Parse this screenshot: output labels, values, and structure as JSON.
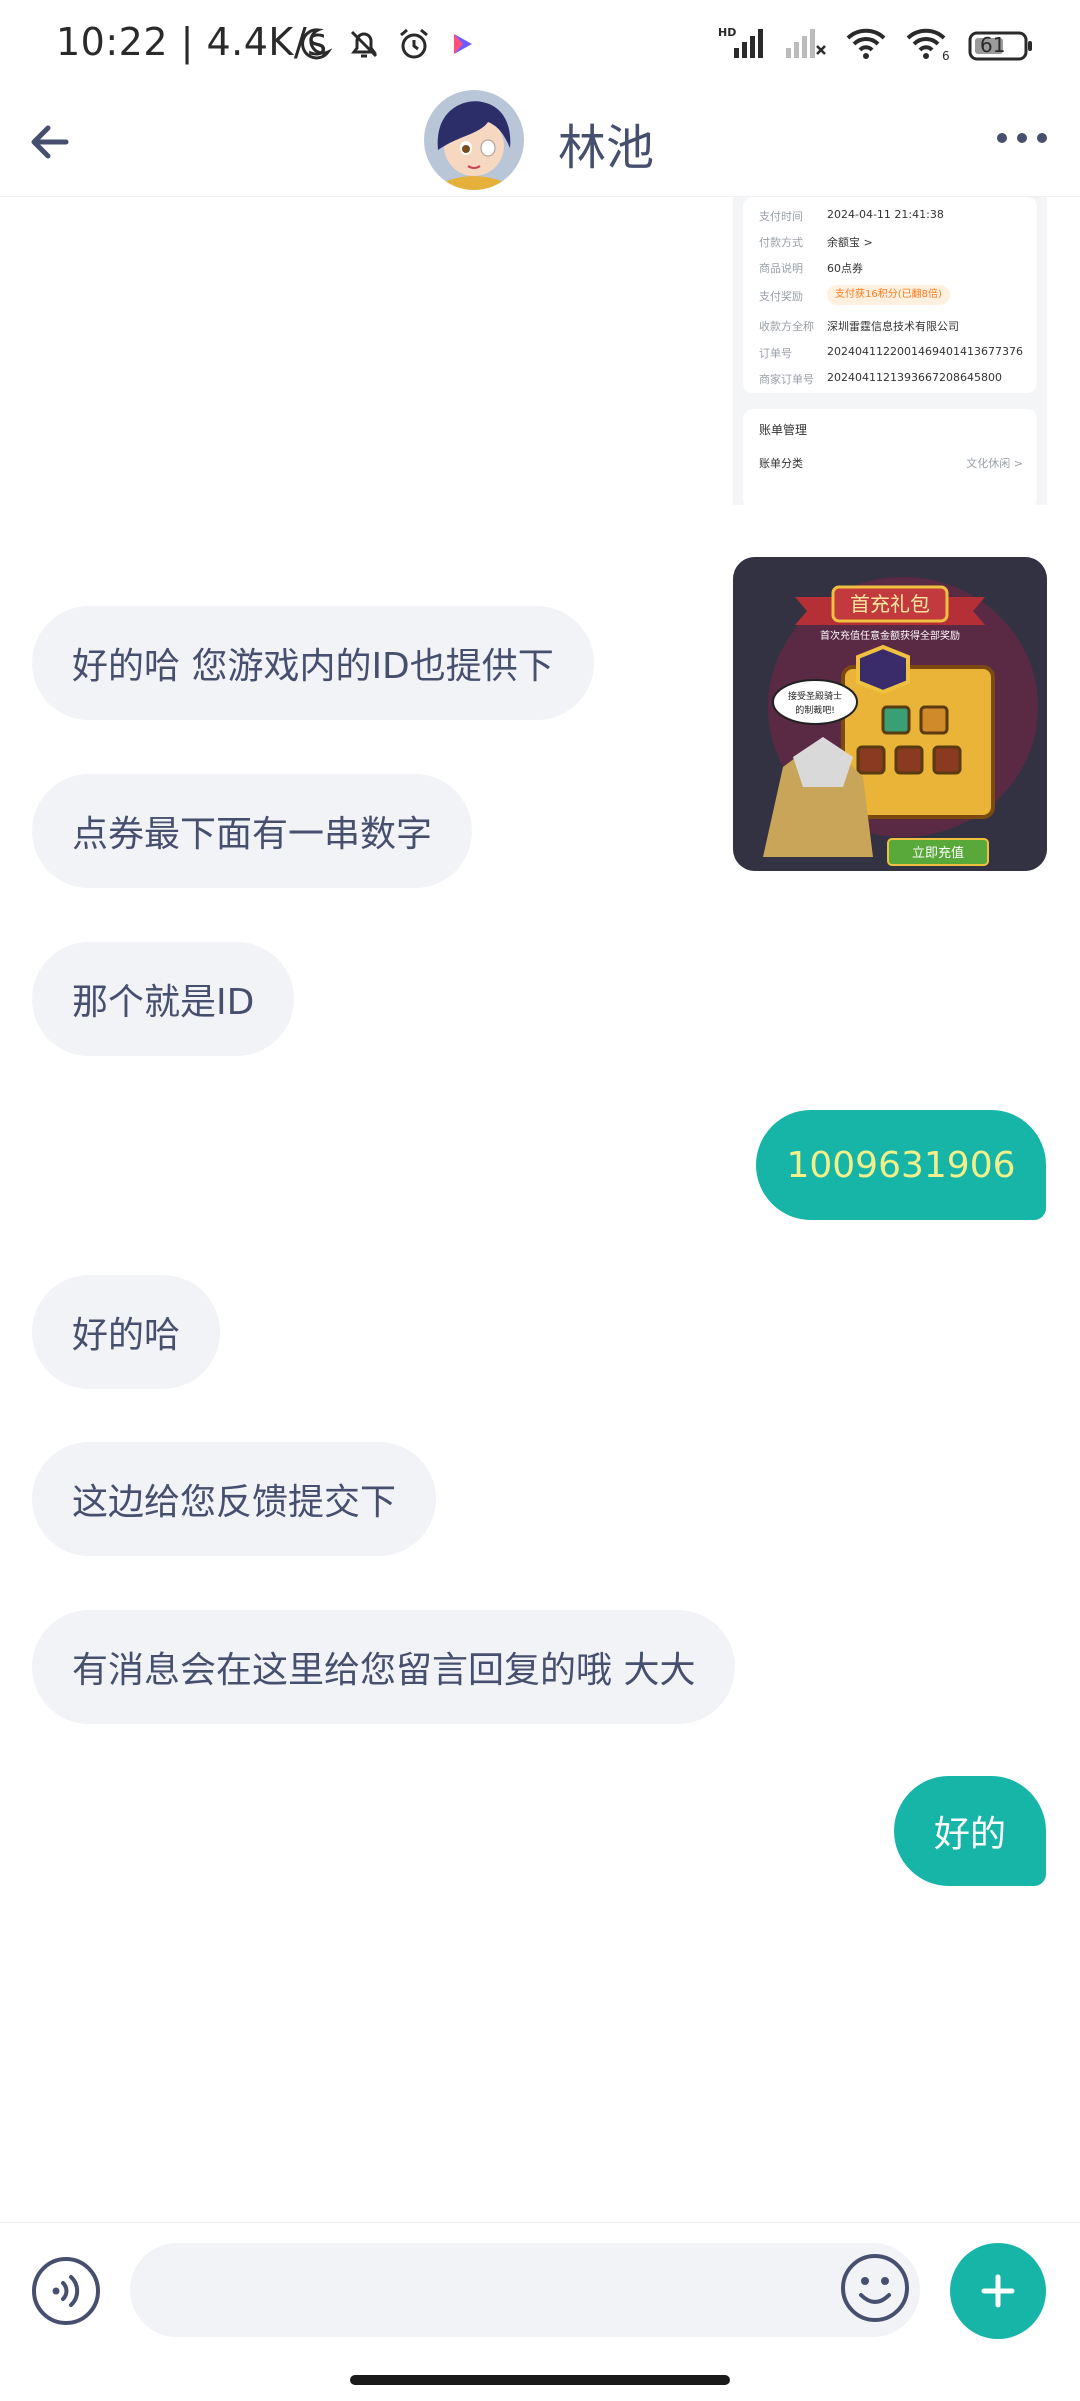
{
  "status_bar": {
    "time_speed": "10:22 | 4.4K/s",
    "battery": "61",
    "hd_label": "HD",
    "wifi_sub": "6"
  },
  "header": {
    "contact_name": "林池",
    "icons": [
      "back-arrow-icon",
      "more-dots-icon"
    ]
  },
  "receipt": {
    "rows": [
      {
        "label": "支付时间",
        "value": "2024-04-11 21:41:38"
      },
      {
        "label": "付款方式",
        "value": "余额宝 >"
      },
      {
        "label": "商品说明",
        "value": "60点券"
      },
      {
        "label": "支付奖励",
        "value": "支付获16积分(已翻8倍)"
      },
      {
        "label": "收款方全称",
        "value": "深圳雷霆信息技术有限公司"
      },
      {
        "label": "订单号",
        "value": "2024041122001469401413677376"
      },
      {
        "label": "商家订单号",
        "value": "20240411213936672086458​00"
      }
    ],
    "section_title": "账单管理",
    "category_label": "账单分类",
    "category_value": "文化休闲 >"
  },
  "game_image": {
    "title": "首充礼包",
    "subtitle": "首次充值任意金额获得全部奖励",
    "speech": "接受圣殿骑士的制裁吧!",
    "button": "立即充值"
  },
  "messages": [
    {
      "dir": "in",
      "text": "好的哈 您游戏内的ID也提供下"
    },
    {
      "dir": "in",
      "text": "点券最下面有一串数字"
    },
    {
      "dir": "in",
      "text": "那个就是ID"
    },
    {
      "dir": "out",
      "text": "1009631906"
    },
    {
      "dir": "in",
      "text": "好的哈"
    },
    {
      "dir": "in",
      "text": "这边给您反馈提交下"
    },
    {
      "dir": "in",
      "text": "有消息会在这里给您留言回复的哦 大大"
    },
    {
      "dir": "out",
      "text": "好的"
    }
  ],
  "colors": {
    "accent": "#17b5a8",
    "bubble_in": "#f1f3f7",
    "text": "#46506e",
    "id_text": "#f2f08a"
  }
}
